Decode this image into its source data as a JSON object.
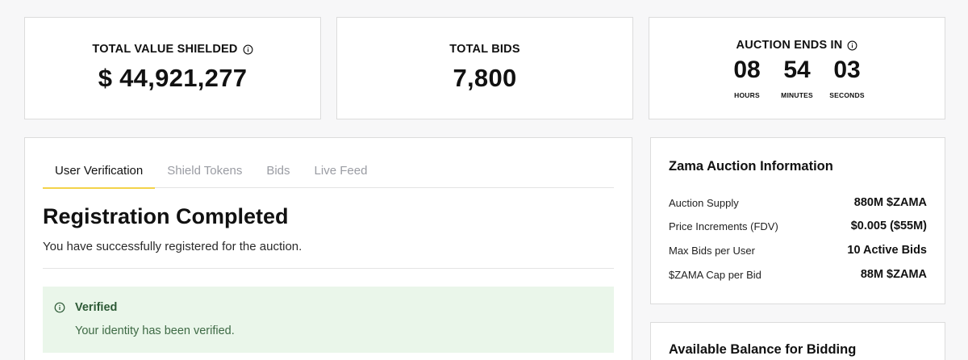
{
  "stats": {
    "shielded": {
      "label": "TOTAL VALUE SHIELDED",
      "value": "$ 44,921,277"
    },
    "bids": {
      "label": "TOTAL BIDS",
      "value": "7,800"
    },
    "auction": {
      "label": "AUCTION ENDS IN",
      "hours": "08",
      "hours_label": "HOURS",
      "minutes": "54",
      "minutes_label": "MINUTES",
      "seconds": "03",
      "seconds_label": "SECONDS"
    }
  },
  "tabs": [
    {
      "label": "User Verification",
      "active": true
    },
    {
      "label": "Shield Tokens",
      "active": false
    },
    {
      "label": "Bids",
      "active": false
    },
    {
      "label": "Live Feed",
      "active": false
    }
  ],
  "registration": {
    "title": "Registration Completed",
    "description": "You have successfully registered for the auction."
  },
  "verified": {
    "title": "Verified",
    "description": "Your identity has been verified."
  },
  "auction_info": {
    "title": "Zama Auction Information",
    "rows": [
      {
        "key": "Auction Supply",
        "value": "880M $ZAMA"
      },
      {
        "key": "Price Increments (FDV)",
        "value": "$0.005 ($55M)"
      },
      {
        "key": "Max Bids per User",
        "value": "10 Active Bids"
      },
      {
        "key": "$ZAMA Cap per Bid",
        "value": "88M $ZAMA"
      }
    ]
  },
  "balance": {
    "title": "Available Balance for Bidding"
  },
  "colors": {
    "accent": "#f3d34a",
    "verified_bg": "#eaf6ea",
    "verified_text": "#2d5a36",
    "page_bg": "#f7f7f8"
  }
}
